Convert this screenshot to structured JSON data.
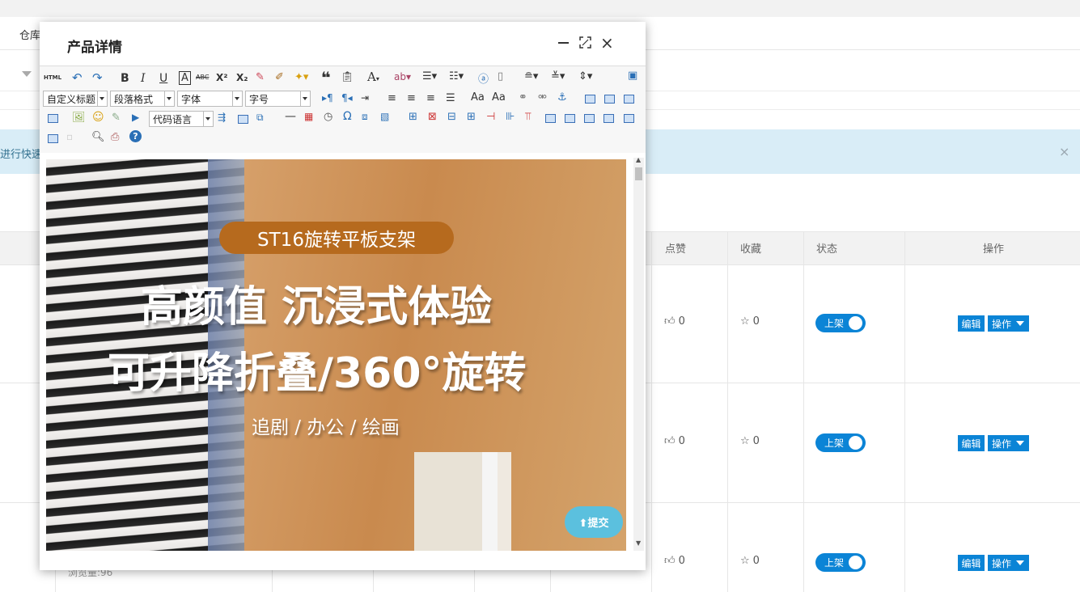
{
  "background": {
    "tab_label": "仓库",
    "notice_text": "进行快速",
    "notice_close": "×",
    "columns": {
      "likes": "点赞",
      "favorites": "收藏",
      "status": "状态",
      "actions": "操作"
    },
    "rows": [
      {
        "likes": "0",
        "favorites": "0",
        "status": "上架",
        "edit": "编辑",
        "op": "操作"
      },
      {
        "likes": "0",
        "favorites": "0",
        "status": "上架",
        "edit": "编辑",
        "op": "操作"
      },
      {
        "likes": "0",
        "favorites": "0",
        "status": "上架",
        "edit": "编辑",
        "op": "操作"
      }
    ],
    "views_text": "浏览量:96",
    "accent_color": "#0b84d6"
  },
  "dialog": {
    "title": "产品详情",
    "minimize_icon": "minimize-icon",
    "maximize_icon": "maximize-icon",
    "close_icon": "×",
    "toolbar": {
      "html_label": "HTML",
      "bold": "B",
      "italic": "I",
      "underline": "U",
      "font_border": "A",
      "strike": "ABC",
      "superscript": "X²",
      "subscript": "X₂",
      "quote": "❝",
      "font_color": "A",
      "custom_title": "自定义标题",
      "paragraph": "段落格式",
      "font_family": "字体",
      "font_size": "字号",
      "code_lang": "代码语言",
      "omega": "Ω",
      "help": "?"
    },
    "banner": {
      "pill": "ST16旋转平板支架",
      "line1": "高颜值 沉浸式体验",
      "line2": "可升降折叠/360°旋转",
      "line3": "追剧 / 办公 / 绘画"
    },
    "submit_label": "⬆提交"
  }
}
